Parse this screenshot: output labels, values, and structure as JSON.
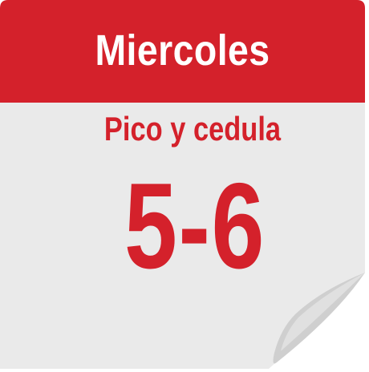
{
  "calendar": {
    "day": "Miercoles",
    "subtitle": "Pico y cedula",
    "digits": "5-6"
  },
  "colors": {
    "header_red": "#d4212b",
    "page_gray": "#eaeaea",
    "curl_shadow": "#cfcfcf",
    "text_red": "#d4212b",
    "header_text": "#ffffff"
  }
}
